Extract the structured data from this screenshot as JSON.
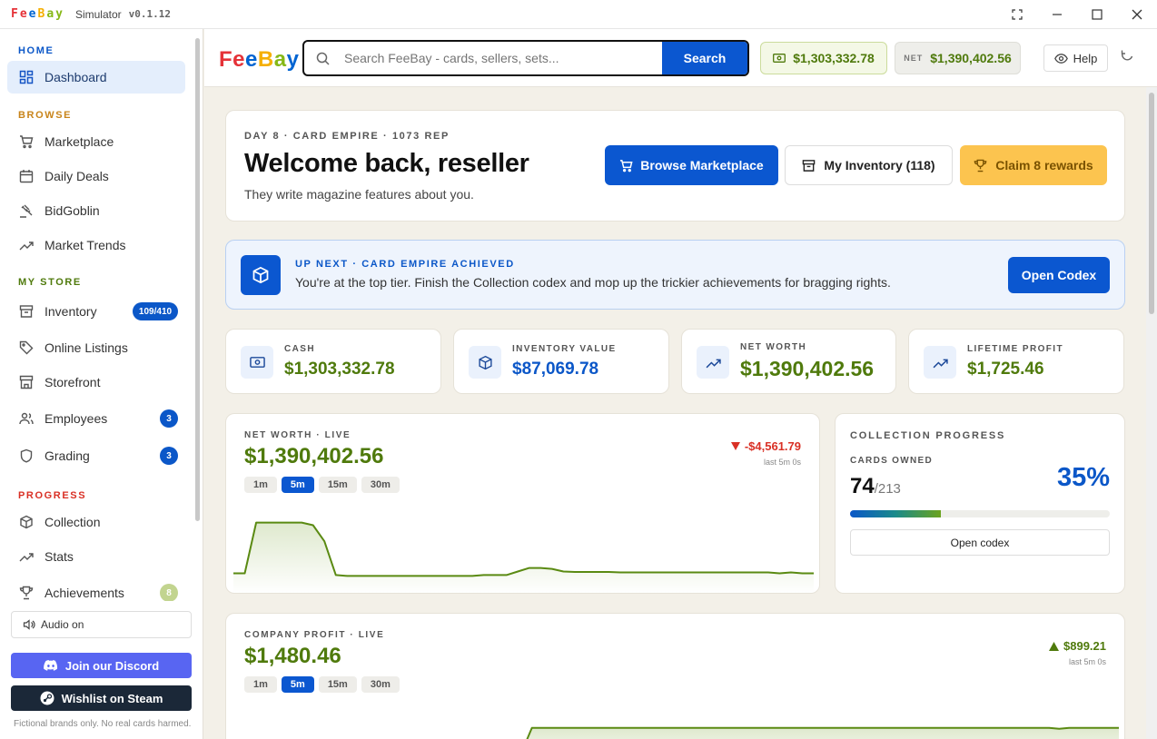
{
  "window": {
    "logo": "FeeBay",
    "title": "Simulator",
    "version": "v0.1.12"
  },
  "sidebar": {
    "sections": {
      "home": "HOME",
      "browse": "BROWSE",
      "store": "MY STORE",
      "progress": "PROGRESS"
    },
    "items": {
      "dashboard": "Dashboard",
      "marketplace": "Marketplace",
      "daily_deals": "Daily Deals",
      "bidgoblin": "BidGoblin",
      "market_trends": "Market Trends",
      "inventory": "Inventory",
      "online_listings": "Online Listings",
      "storefront": "Storefront",
      "employees": "Employees",
      "grading": "Grading",
      "collection": "Collection",
      "stats": "Stats",
      "achievements": "Achievements"
    },
    "badges": {
      "inventory": "109/410",
      "employees": "3",
      "grading": "3",
      "achievements": "8"
    },
    "audio": "Audio on",
    "discord": "Join our Discord",
    "steam": "Wishlist on Steam",
    "fine_print": "Fictional brands only. No real cards harmed."
  },
  "topbar": {
    "brand": "FeeBay",
    "search_placeholder": "Search FeeBay - cards, sellers, sets...",
    "search_button": "Search",
    "cash": "$1,303,332.78",
    "net_label": "NET",
    "net": "$1,390,402.56",
    "help": "Help"
  },
  "welcome": {
    "eyebrow": "DAY 8 · CARD EMPIRE · 1073 REP",
    "title": "Welcome back, reseller",
    "subtitle": "They write magazine features about you.",
    "browse_button": "Browse Marketplace",
    "inventory_button": "My Inventory (118)",
    "rewards_button": "Claim 8 rewards"
  },
  "upnext": {
    "eyebrow": "UP NEXT · CARD EMPIRE ACHIEVED",
    "text": "You're at the top tier. Finish the Collection codex and mop up the trickier achievements for bragging rights.",
    "button": "Open Codex"
  },
  "stats": {
    "cash_label": "CASH",
    "cash": "$1,303,332.78",
    "inv_label": "INVENTORY VALUE",
    "inv": "$87,069.78",
    "net_label": "NET WORTH",
    "net": "$1,390,402.56",
    "life_label": "LIFETIME PROFIT",
    "life": "$1,725.46"
  },
  "networth_chart": {
    "eyebrow": "NET WORTH · LIVE",
    "value": "$1,390,402.56",
    "delta": "-$4,561.79",
    "delta_period": "last 5m 0s",
    "ranges": [
      "1m",
      "5m",
      "15m",
      "30m"
    ],
    "selected_range": "5m"
  },
  "collection": {
    "eyebrow": "COLLECTION PROGRESS",
    "owned_label": "CARDS OWNED",
    "owned": "74",
    "total": "/213",
    "percent": "35%",
    "progress": 0.35,
    "button": "Open codex"
  },
  "profit_chart": {
    "eyebrow": "COMPANY PROFIT · LIVE",
    "value": "$1,480.46",
    "delta": "$899.21",
    "delta_period": "last 5m 0s",
    "ranges": [
      "1m",
      "5m",
      "15m",
      "30m"
    ],
    "selected_range": "5m"
  },
  "colors": {
    "accent": "#0b57d0",
    "money_green": "#4f7a0c",
    "negative": "#d93025",
    "rewards": "#fcc44f"
  },
  "chart_data": [
    {
      "type": "area",
      "series": [
        {
          "values": [
            1389200,
            1389200,
            1394900,
            1394900,
            1394900,
            1394900,
            1394900,
            1394600,
            1392800,
            1389000,
            1388900,
            1388900,
            1388900,
            1388900,
            1388900,
            1388900,
            1388900,
            1388900,
            1388900,
            1388900,
            1388900,
            1388900,
            1389000,
            1389000,
            1389000,
            1389400,
            1389800,
            1389800,
            1389700,
            1389400,
            1389350,
            1389350,
            1389350,
            1389350,
            1389300,
            1389300,
            1389300,
            1389300,
            1389300,
            1389300,
            1389300,
            1389300,
            1389300,
            1389300,
            1389300,
            1389300,
            1389300,
            1389300,
            1389200,
            1389300,
            1389200,
            1389200
          ]
        }
      ],
      "ylim": [
        1386900,
        1396900
      ],
      "grid": false
    },
    {
      "type": "area",
      "series": [
        {
          "values": [
            580,
            580,
            580,
            580,
            580,
            580,
            580,
            580,
            580,
            580,
            580,
            580,
            580,
            580,
            580,
            580,
            580,
            580,
            580,
            580,
            580,
            580,
            580,
            580,
            580,
            580,
            580,
            580,
            580,
            580,
            1480,
            1480,
            1480,
            1480,
            1480,
            1480,
            1480,
            1480,
            1480,
            1480,
            1480,
            1480,
            1480,
            1480,
            1480,
            1480,
            1480,
            1480,
            1480,
            1480,
            1480,
            1480,
            1480,
            1480,
            1480,
            1480,
            1480,
            1480,
            1480,
            1480,
            1480,
            1480,
            1480,
            1480,
            1480,
            1480,
            1480,
            1480,
            1480,
            1480,
            1480,
            1480,
            1480,
            1480,
            1480,
            1480,
            1480,
            1480,
            1480,
            1480,
            1480,
            1480,
            1480,
            1440,
            1480,
            1480,
            1480,
            1480,
            1480,
            1480
          ]
        }
      ],
      "ylim": [
        300,
        2500
      ],
      "grid": false
    }
  ]
}
